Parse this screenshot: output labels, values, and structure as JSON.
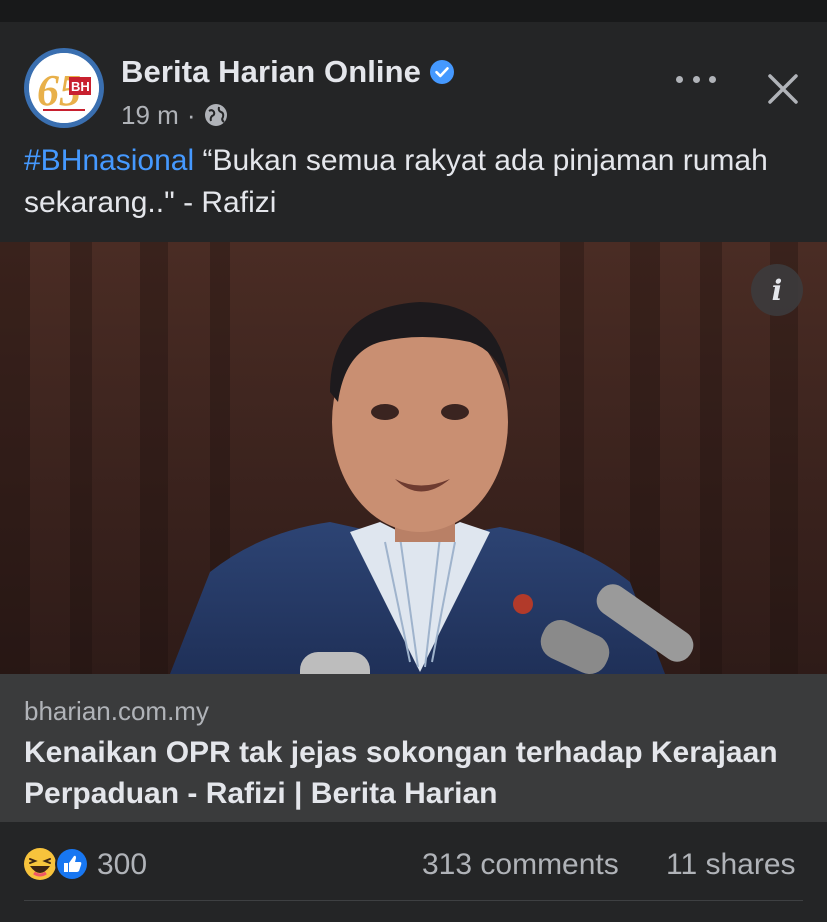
{
  "post": {
    "page_name": "Berita Harian Online",
    "verified": true,
    "time": "19 m",
    "separator": "·",
    "audience_icon": "globe-icon",
    "hashtag": "#BHnasional",
    "text": " “Bukan semua rakyat ada pinjaman rumah sekarang..\" - Rafizi"
  },
  "avatar": {
    "logo_number": "65",
    "logo_badge": "BH"
  },
  "link_preview": {
    "domain": "bharian.com.my",
    "title": "Kenaikan OPR tak jejas sokongan terhadap Kerajaan Perpaduan - Rafizi | Berita Harian"
  },
  "stats": {
    "reactions": [
      "haha-icon",
      "like-icon"
    ],
    "reaction_count": "300",
    "comments": "313 comments",
    "shares": "11 shares"
  },
  "colors": {
    "background": "#242526",
    "link_box": "#3a3b3c",
    "hashtag": "#4599ff",
    "verified": "#4599ff",
    "secondary_text": "#b0b3b8"
  }
}
